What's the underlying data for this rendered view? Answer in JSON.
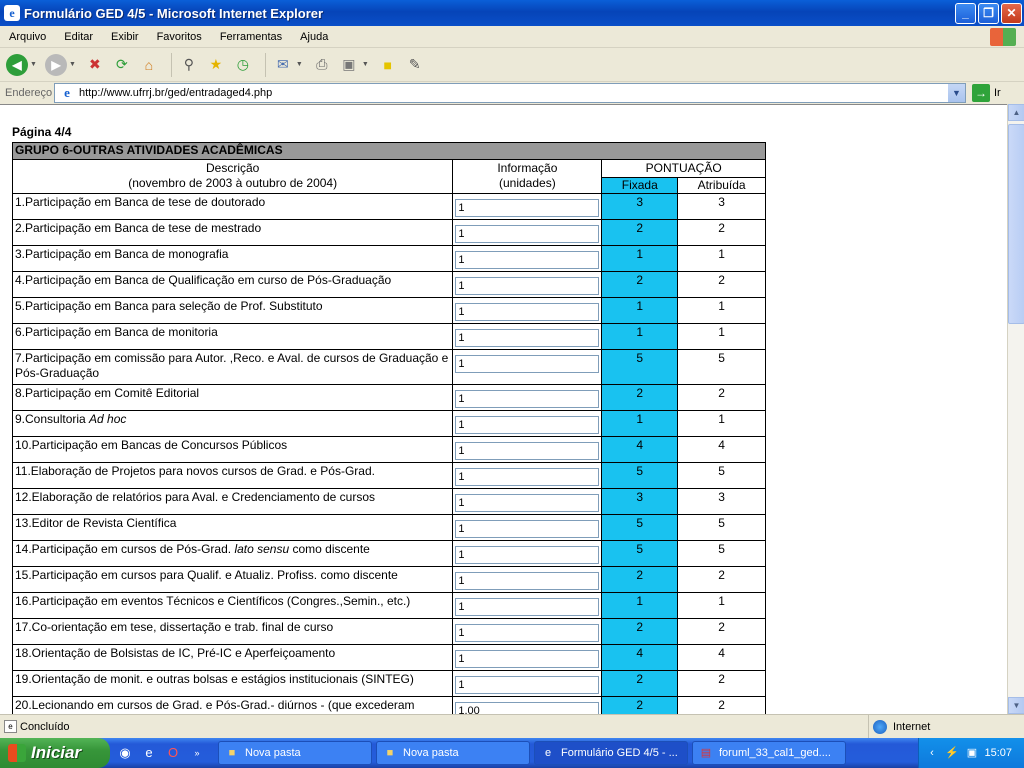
{
  "window": {
    "title": "Formulário GED 4/5 - Microsoft Internet Explorer",
    "buttons": {
      "minimize": "_",
      "maximize": "❐",
      "close": "✕"
    }
  },
  "menu": [
    "Arquivo",
    "Editar",
    "Exibir",
    "Favoritos",
    "Ferramentas",
    "Ajuda"
  ],
  "address": {
    "label": "Endereço",
    "url": "http://www.ufrrj.br/ged/entradaged4.php",
    "go_label": "Ir"
  },
  "page": {
    "title": "Página 4/4",
    "group_title": "GRUPO 6-OUTRAS ATIVIDADES ACADÊMICAS",
    "header": {
      "descricao": "Descrição",
      "periodo": "(novembro de 2003 à outubro de 2004)",
      "informacao": "Informação",
      "unidades": "(unidades)",
      "pontuacao": "PONTUAÇÃO",
      "fixada": "Fixada",
      "atribuida": "Atribuída"
    },
    "rows": [
      {
        "pre": "1.Participação em Banca de tese de doutorado",
        "em": "",
        "post": "",
        "info": "1",
        "fixada": "3",
        "atribuida": "3"
      },
      {
        "pre": "2.Participação em Banca de tese de mestrado",
        "em": "",
        "post": "",
        "info": "1",
        "fixada": "2",
        "atribuida": "2"
      },
      {
        "pre": "3.Participação em Banca de monografia",
        "em": "",
        "post": "",
        "info": "1",
        "fixada": "1",
        "atribuida": "1"
      },
      {
        "pre": "4.Participação em Banca de Qualificação em curso de Pós-Graduação",
        "em": "",
        "post": "",
        "info": "1",
        "fixada": "2",
        "atribuida": "2"
      },
      {
        "pre": "5.Participação em Banca para seleção de Prof. Substituto",
        "em": "",
        "post": "",
        "info": "1",
        "fixada": "1",
        "atribuida": "1"
      },
      {
        "pre": "6.Participação em Banca de monitoria",
        "em": "",
        "post": "",
        "info": "1",
        "fixada": "1",
        "atribuida": "1"
      },
      {
        "pre": "7.Participação em comissão para Autor. ,Reco. e Aval. de cursos de Graduação e Pós-Graduação",
        "em": "",
        "post": "",
        "info": "1",
        "fixada": "5",
        "atribuida": "5",
        "tall": true
      },
      {
        "pre": "8.Participação em Comitê Editorial",
        "em": "",
        "post": "",
        "info": "1",
        "fixada": "2",
        "atribuida": "2"
      },
      {
        "pre": "9.Consultoria ",
        "em": "Ad hoc",
        "post": "",
        "info": "1",
        "fixada": "1",
        "atribuida": "1"
      },
      {
        "pre": "10.Participação em Bancas de Concursos Públicos",
        "em": "",
        "post": "",
        "info": "1",
        "fixada": "4",
        "atribuida": "4"
      },
      {
        "pre": "11.Elaboração de Projetos para novos cursos de Grad. e Pós-Grad.",
        "em": "",
        "post": "",
        "info": "1",
        "fixada": "5",
        "atribuida": "5"
      },
      {
        "pre": "12.Elaboração de relatórios para Aval. e Credenciamento de cursos",
        "em": "",
        "post": "",
        "info": "1",
        "fixada": "3",
        "atribuida": "3"
      },
      {
        "pre": "13.Editor de Revista Científica",
        "em": "",
        "post": "",
        "info": "1",
        "fixada": "5",
        "atribuida": "5"
      },
      {
        "pre": "14.Participação em cursos de Pós-Grad. ",
        "em": "lato sensu",
        "post": " como discente",
        "info": "1",
        "fixada": "5",
        "atribuida": "5"
      },
      {
        "pre": "15.Participação em cursos para Qualif. e Atualiz. Profiss. como discente",
        "em": "",
        "post": "",
        "info": "1",
        "fixada": "2",
        "atribuida": "2"
      },
      {
        "pre": "16.Participação em eventos Técnicos e Científicos (Congres.,Semin., etc.)",
        "em": "",
        "post": "",
        "info": "1",
        "fixada": "1",
        "atribuida": "1"
      },
      {
        "pre": "17.Co-orientação em tese, dissertação e trab. final de curso",
        "em": "",
        "post": "",
        "info": "1",
        "fixada": "2",
        "atribuida": "2"
      },
      {
        "pre": "18.Orientação de Bolsistas de IC, Pré-IC e Aperfeiçoamento",
        "em": "",
        "post": "",
        "info": "1",
        "fixada": "4",
        "atribuida": "4"
      },
      {
        "pre": "19.Orientação de monit. e outras bolsas e estágios institucionais (SINTEG)",
        "em": "",
        "post": "",
        "info": "1",
        "fixada": "2",
        "atribuida": "2"
      },
      {
        "pre": "20.Lecionando em cursos de Grad. e Pós-Grad.- diúrnos - (que excederam",
        "em": "",
        "post": "",
        "info": "1.00",
        "fixada": "2",
        "atribuida": "2"
      }
    ]
  },
  "status": {
    "text": "Concluído",
    "zone": "Internet"
  },
  "taskbar": {
    "start_label": "Iniciar",
    "tasks": [
      {
        "label": "Nova pasta",
        "icon": "folder-icon"
      },
      {
        "label": "Nova pasta",
        "icon": "folder-icon"
      },
      {
        "label": "Formulário GED 4/5 - ...",
        "icon": "ie-icon",
        "active": true
      },
      {
        "label": "foruml_33_cal1_ged....",
        "icon": "winrar-icon"
      }
    ],
    "clock": "15:07"
  }
}
